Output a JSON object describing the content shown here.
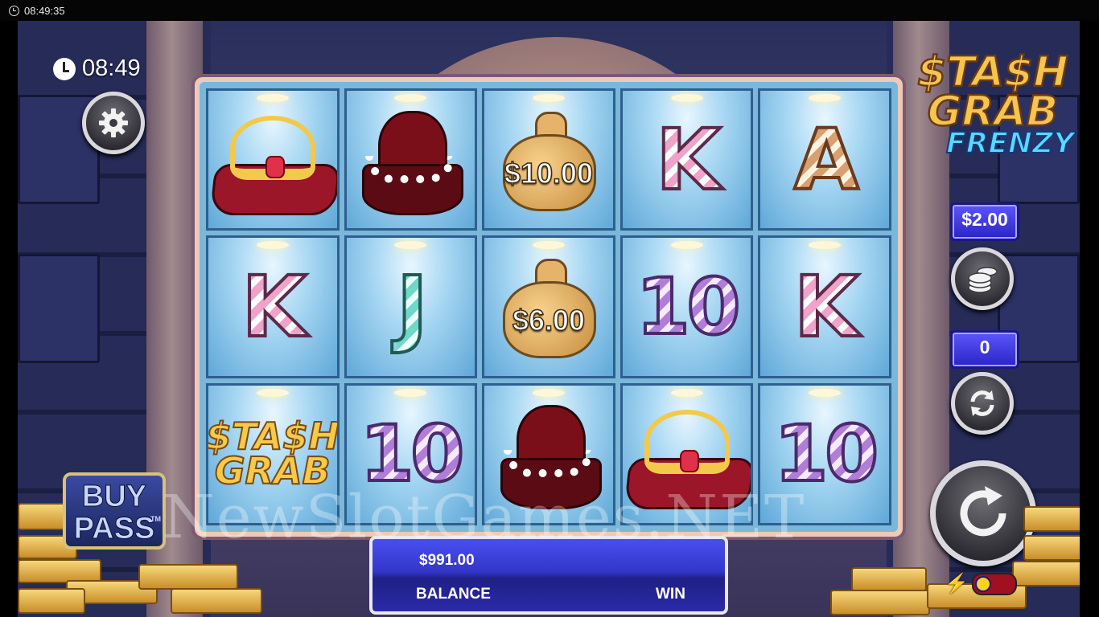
{
  "os_status": {
    "time": "08:49:35"
  },
  "game": {
    "clock": "08:49",
    "logo": {
      "line1": "$TA$H",
      "line2": "GRAB",
      "line3": "FRENZY",
      "amp": "&"
    },
    "bet": "$2.00",
    "autoplay_count": "0",
    "buy_pass": {
      "line1": "BUY",
      "line2": "PASS",
      "tm": "TM"
    },
    "balance_value": "$991.00",
    "balance_label": "BALANCE",
    "win_label": "WIN",
    "watermark": "NewSlotGames.NET"
  },
  "reels": [
    [
      {
        "symbol": "tiara"
      },
      {
        "symbol": "pearl-necklace"
      },
      {
        "symbol": "money-bag",
        "value": "$10.00"
      },
      {
        "symbol": "letter",
        "text": "K"
      },
      {
        "symbol": "letter",
        "text": "A"
      }
    ],
    [
      {
        "symbol": "letter",
        "text": "K"
      },
      {
        "symbol": "letter",
        "text": "J"
      },
      {
        "symbol": "money-bag",
        "value": "$6.00"
      },
      {
        "symbol": "letter",
        "text": "10"
      },
      {
        "symbol": "letter",
        "text": "K"
      }
    ],
    [
      {
        "symbol": "stash-grab-logo",
        "line1": "$TA$H",
        "line2": "GRAB",
        "amp": "&"
      },
      {
        "symbol": "letter",
        "text": "10"
      },
      {
        "symbol": "pearl-necklace"
      },
      {
        "symbol": "tiara"
      },
      {
        "symbol": "letter",
        "text": "10"
      }
    ]
  ],
  "colors": {
    "accent": "#3a3ad8",
    "gold": "#f5c451",
    "frenzy": "#59d8ff"
  }
}
